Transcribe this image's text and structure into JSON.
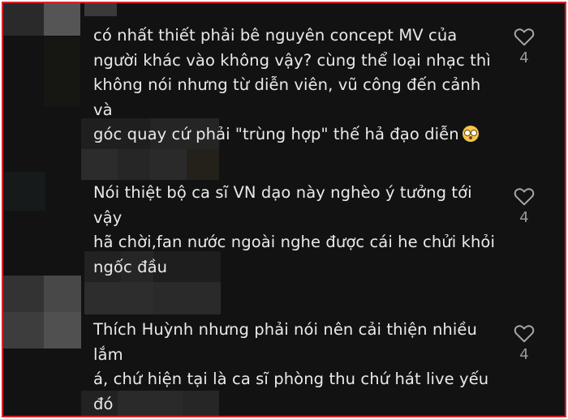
{
  "comments": [
    {
      "lines": [
        "có nhất thiết phải bê nguyên concept MV của",
        "người khác vào không vậy? cùng thể loại nhạc thì",
        "không nói nhưng từ diễn viên, vũ công đến cảnh và",
        "góc quay cứ phải \"trùng hợp\" thế hả đạo diễn"
      ],
      "emoji": "flushed-face-emoji",
      "likes": "4"
    },
    {
      "lines": [
        "Nói thiệt bộ ca sĩ VN dạo này nghèo ý tưởng tới vậy",
        "hã chời,fan nước ngoài nghe được cái he chửi khỏi",
        "ngốc đầu"
      ],
      "likes": "4"
    },
    {
      "lines": [
        "Thích Huỳnh nhưng phải nói nên cải thiện nhiều lắm",
        "á, chứ hiện tại là ca sĩ phòng thu chứ hát live yếu",
        "đó"
      ],
      "likes": "4"
    }
  ],
  "colors": {
    "background": "#121212",
    "text": "#eaeaea",
    "count": "#9a9a9a",
    "border": "#d8232a"
  }
}
